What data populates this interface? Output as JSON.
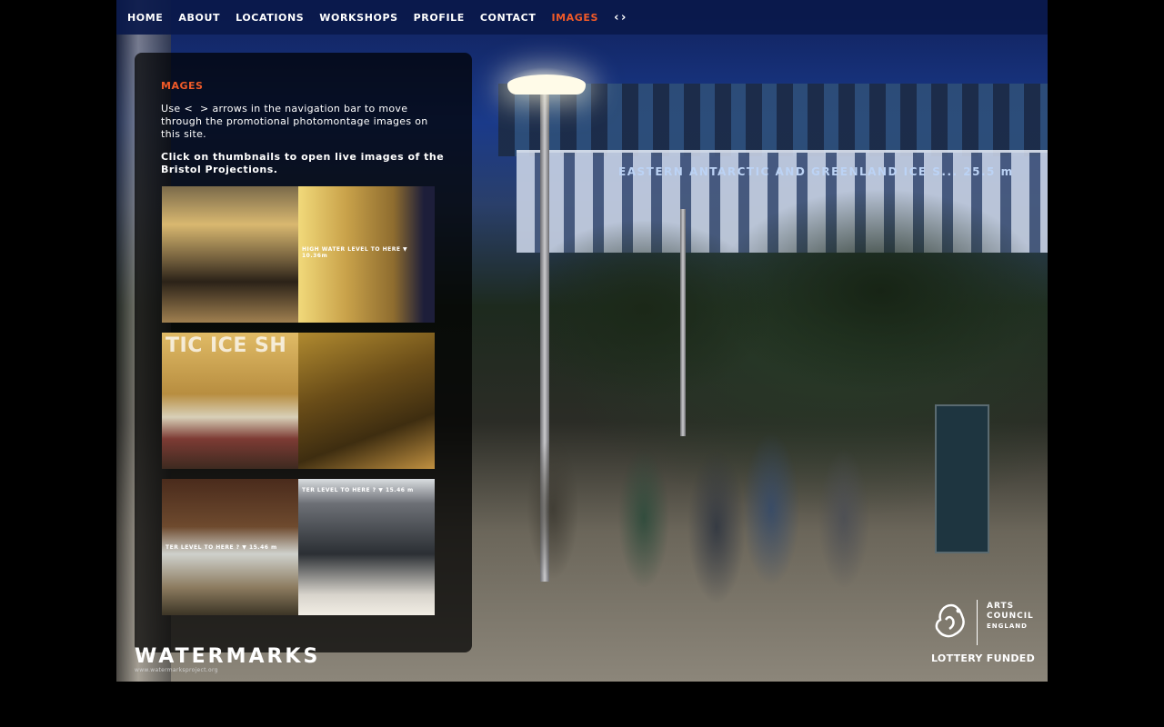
{
  "nav": {
    "items": [
      {
        "label": "HOME",
        "active": false
      },
      {
        "label": "ABOUT",
        "active": false
      },
      {
        "label": "LOCATIONS",
        "active": false
      },
      {
        "label": "WORKSHOPS",
        "active": false
      },
      {
        "label": "PROFILE",
        "active": false
      },
      {
        "label": "CONTACT",
        "active": false
      },
      {
        "label": "IMAGES",
        "active": true
      }
    ],
    "prev_arrow": "‹",
    "next_arrow": "›"
  },
  "background": {
    "banner_text": "EASTERN ANTARCTIC AND GREENLAND ICE S... 25.5 m"
  },
  "panel": {
    "title": "MAGES",
    "desc_prefix": "Use",
    "desc_lt": "<",
    "desc_gt": ">",
    "desc_suffix": "arrows in the navigation bar to move through the promotional photomontage images on this site.",
    "cta": "Click on thumbnails to open live images of the Bristol Projections.",
    "thumbnails": [
      {
        "caption": ""
      },
      {
        "caption": "HIGH WATER LEVEL TO HERE ▼   10.36m"
      },
      {
        "caption": "TIC ICE SH"
      },
      {
        "caption": ""
      },
      {
        "caption": "TER LEVEL TO HERE ? ▼   15.46 m"
      },
      {
        "caption": "TER LEVEL TO HERE ? ▼   15.46 m"
      }
    ]
  },
  "footer": {
    "logo_text": "WATERMARKS",
    "logo_url_text": "www.watermarksproject.org",
    "arts_council_line1": "ARTS",
    "arts_council_line2": "COUNCIL",
    "arts_council_line3": "ENGLAND",
    "lottery_text": "LOTTERY FUNDED"
  },
  "colors": {
    "nav_bg": "#0a194b",
    "accent": "#f05a28"
  }
}
